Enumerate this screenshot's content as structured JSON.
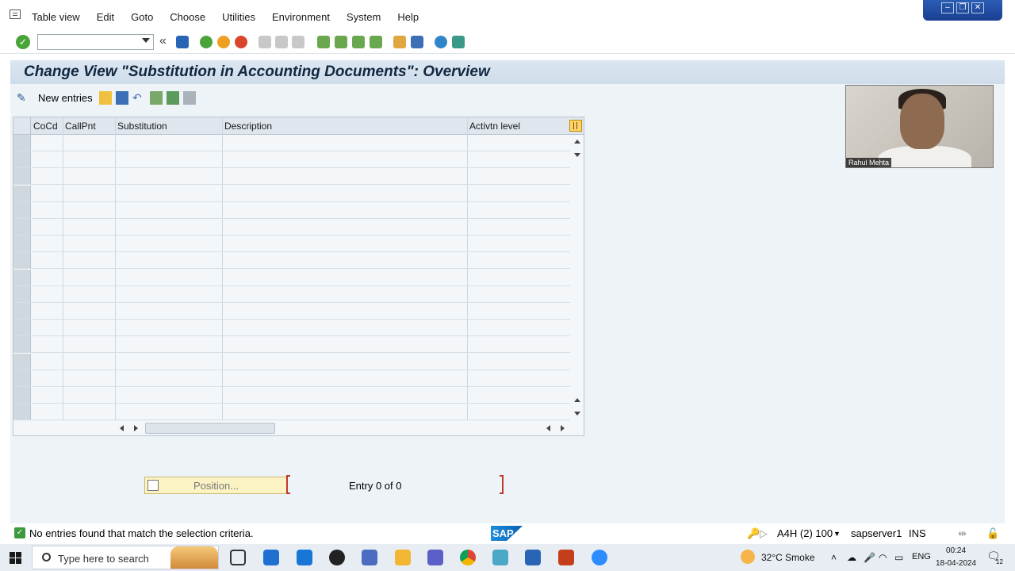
{
  "menu": {
    "items": [
      {
        "label": "Table view"
      },
      {
        "label": "Edit"
      },
      {
        "label": "Goto"
      },
      {
        "label": "Choose"
      },
      {
        "label": "Utilities"
      },
      {
        "label": "Environment"
      },
      {
        "label": "System"
      },
      {
        "label": "Help"
      }
    ]
  },
  "window": {
    "title": "Change View \"Substitution in Accounting Documents\": Overview"
  },
  "app_toolbar": {
    "new_entries": "New entries"
  },
  "table": {
    "columns": [
      "CoCd",
      "CallPnt",
      "Substitution",
      "Description",
      "Activtn level"
    ],
    "row_count_visible": 17,
    "rows": []
  },
  "footer": {
    "position_label": "Position...",
    "entry_label": "Entry 0 of 0"
  },
  "status": {
    "message": "No entries found that match the selection criteria.",
    "sap_logo": "SAP",
    "system": "A4H (2) 100",
    "server": "sapserver1",
    "mode": "INS"
  },
  "video": {
    "participant": "Rahul Mehta"
  },
  "taskbar": {
    "search_placeholder": "Type here to search",
    "weather": "32°C  Smoke",
    "language": "ENG",
    "time": "00:24",
    "date": "18-04-2024",
    "notifications": "12"
  },
  "colors": {
    "ok_green": "#4aa43a",
    "title_bg": "#cfdcea",
    "accent": "#0a6ed1"
  }
}
